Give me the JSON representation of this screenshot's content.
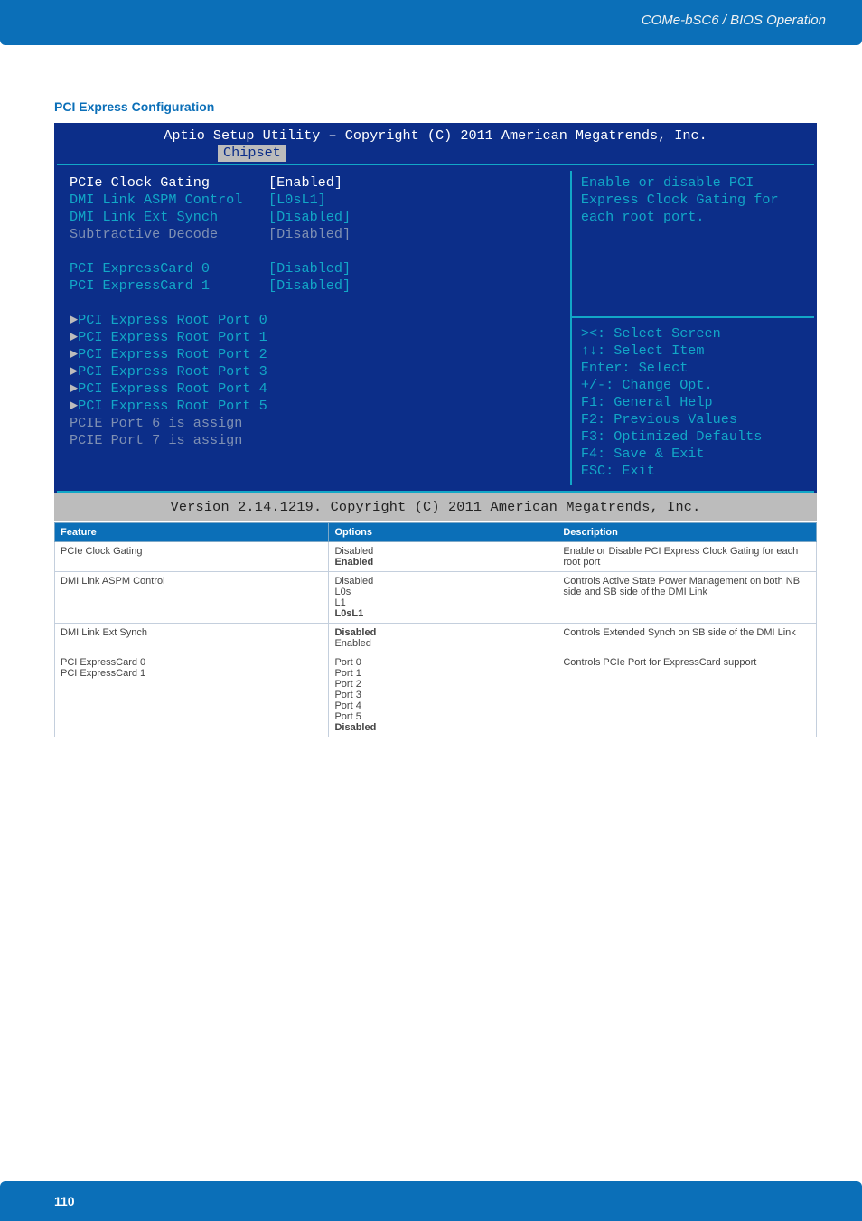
{
  "header": {
    "breadcrumb": "COMe-bSC6 / BIOS Operation"
  },
  "section": {
    "title": "PCI Express Configuration"
  },
  "bios": {
    "title": "Aptio Setup Utility – Copyright (C) 2011 American Megatrends, Inc.",
    "tab": "Chipset",
    "settings_group1": [
      {
        "label": "PCIe Clock Gating",
        "value": "[Enabled]",
        "highlight": true
      },
      {
        "label": "DMI Link ASPM Control",
        "value": "[L0sL1]"
      },
      {
        "label": "DMI Link Ext Synch",
        "value": "[Disabled]"
      },
      {
        "label": "Subtractive Decode",
        "value": "[Disabled]",
        "dim": true
      }
    ],
    "settings_group2": [
      {
        "label": "PCI ExpressCard 0",
        "value": "[Disabled]"
      },
      {
        "label": "PCI ExpressCard 1",
        "value": "[Disabled]"
      }
    ],
    "submenus": [
      "PCI Express Root Port 0",
      "PCI Express Root Port 1",
      "PCI Express Root Port 2",
      "PCI Express Root Port 3",
      "PCI Express Root Port 4",
      "PCI Express Root Port 5"
    ],
    "disabled_lines": [
      "PCIE Port 6 is assign",
      "PCIE Port 7 is assign"
    ],
    "help_text": "Enable or disable PCI Express Clock Gating for each root port.",
    "legend": [
      "><: Select Screen",
      "↑↓: Select Item",
      "Enter: Select",
      "+/-: Change Opt.",
      "F1: General Help",
      "F2: Previous Values",
      "F3: Optimized Defaults",
      "F4: Save & Exit",
      "ESC: Exit"
    ],
    "footer": "Version 2.14.1219. Copyright (C) 2011 American Megatrends, Inc."
  },
  "table": {
    "headers": [
      "Feature",
      "Options",
      "Description"
    ],
    "rows": [
      {
        "feature": "PCIe Clock Gating",
        "options": [
          "Disabled",
          "Enabled"
        ],
        "bold_idx": [
          1
        ],
        "description": "Enable or Disable PCI Express Clock Gating for each root port"
      },
      {
        "feature": "DMI Link ASPM Control",
        "options": [
          "Disabled",
          "L0s",
          "L1",
          "L0sL1"
        ],
        "bold_idx": [
          3
        ],
        "description": "Controls Active State Power Management on both NB side and SB side of the DMI Link"
      },
      {
        "feature": "DMI Link Ext Synch",
        "options": [
          "Disabled",
          "Enabled"
        ],
        "bold_idx": [
          0
        ],
        "description": "Controls Extended Synch on SB side of the DMI Link"
      },
      {
        "feature": "PCI ExpressCard 0\nPCI ExpressCard 1",
        "options": [
          "Port 0",
          "Port 1",
          "Port 2",
          "Port 3",
          "Port 4",
          "Port 5",
          "Disabled"
        ],
        "bold_idx": [
          6
        ],
        "description": "Controls PCIe Port for ExpressCard support"
      }
    ]
  },
  "footer": {
    "page_number": "110"
  }
}
